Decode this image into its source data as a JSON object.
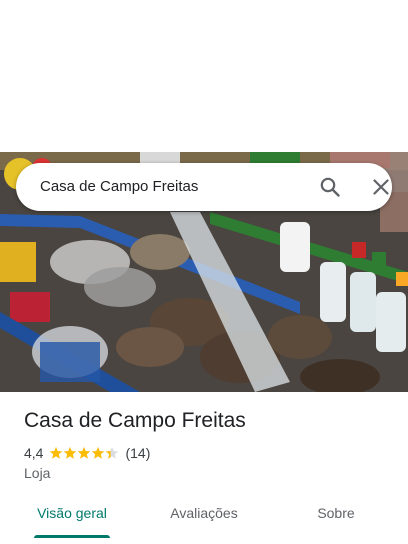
{
  "search": {
    "query": "Casa de Campo Freitas"
  },
  "place": {
    "name": "Casa de Campo Freitas",
    "rating": "4,4",
    "stars": 4.4,
    "review_count": "(14)",
    "category": "Loja"
  },
  "tabs": [
    {
      "label": "Visão geral",
      "active": true
    },
    {
      "label": "Avaliações",
      "active": false
    },
    {
      "label": "Sobre",
      "active": false
    }
  ],
  "colors": {
    "accent": "#00796b",
    "star": "#fbbc04",
    "star_empty": "#dadce0"
  }
}
